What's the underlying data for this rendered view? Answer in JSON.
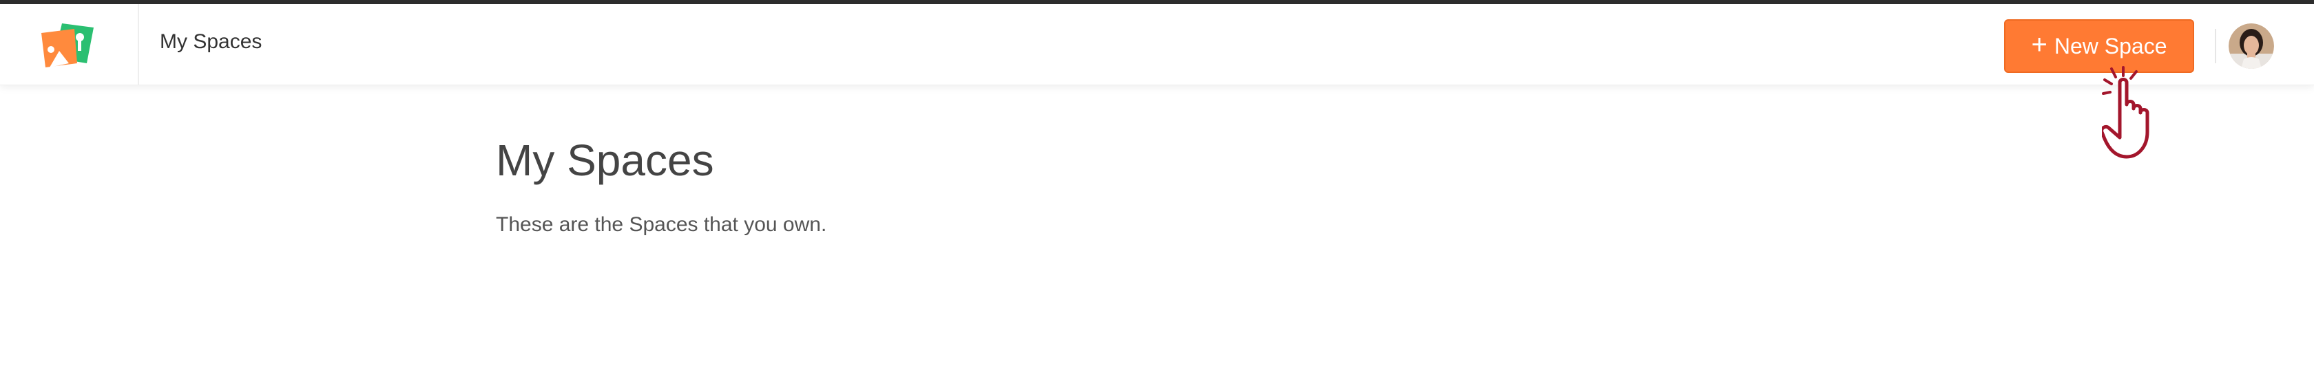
{
  "header": {
    "logo_icon": "spaces-logo-icon",
    "title": "My Spaces",
    "new_space_label": "New Space",
    "new_space_icon": "plus-icon",
    "avatar_icon": "user-avatar"
  },
  "main": {
    "heading": "My Spaces",
    "subtitle": "These are the Spaces that you own."
  },
  "colors": {
    "accent": "#ff7a33",
    "top_strip": "#2d2d2d",
    "logo_orange": "#ff8a3d",
    "logo_green": "#2bbf71",
    "cursor": "#a3162c"
  }
}
